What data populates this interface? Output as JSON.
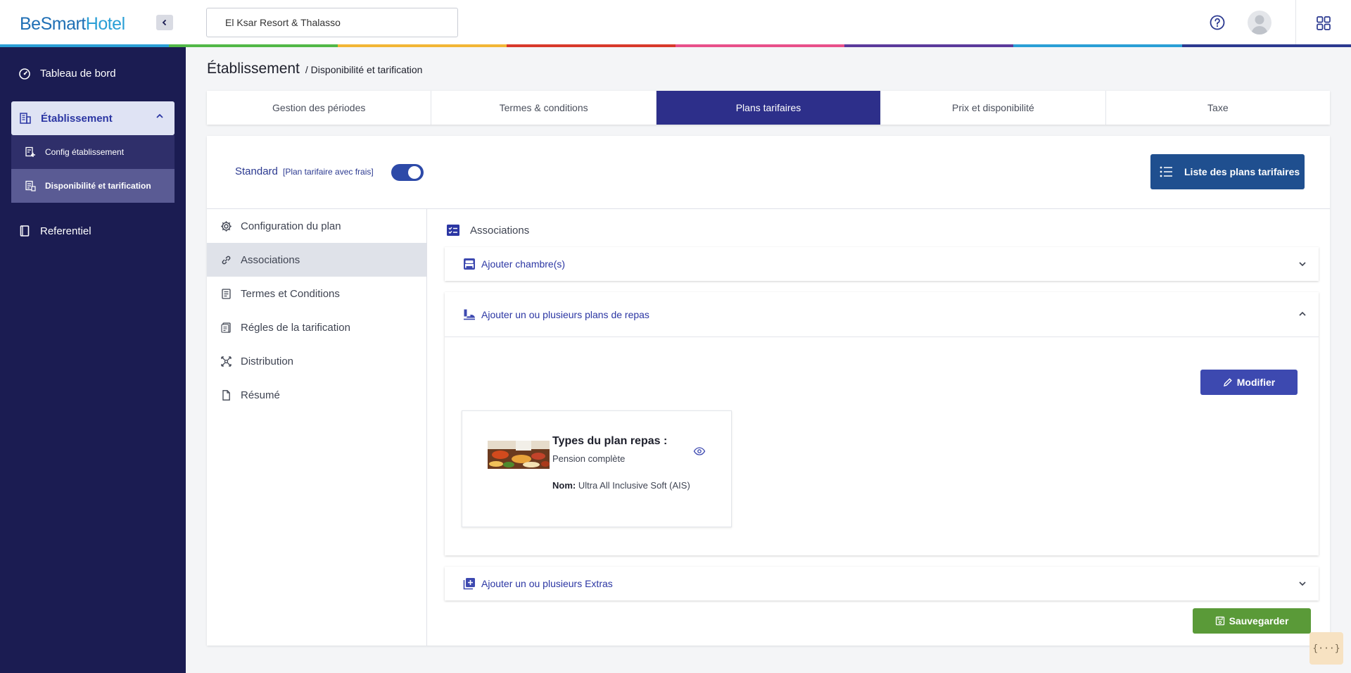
{
  "brand": {
    "part1": "BeSmart",
    "part2": "Hotel"
  },
  "sidebar": {
    "items": [
      {
        "label": "Tableau de bord",
        "icon": "gauge-icon"
      },
      {
        "label": "Établissement",
        "icon": "building-icon"
      },
      {
        "label": "Referentiel",
        "icon": "book-icon"
      }
    ],
    "subitems": [
      {
        "label": "Config établissement",
        "icon": "config-doc-icon"
      },
      {
        "label": "Disponibilité et tarification",
        "icon": "pricing-doc-icon"
      }
    ]
  },
  "topbar": {
    "hotel": "El Ksar Resort & Thalasso"
  },
  "breadcrumb": {
    "title": "Établissement",
    "sub": "/ Disponibilité et tarification"
  },
  "tabs": [
    {
      "label": "Gestion des périodes"
    },
    {
      "label": "Termes & conditions"
    },
    {
      "label": "Plans tarifaires"
    },
    {
      "label": "Prix et disponibilité"
    },
    {
      "label": "Taxe"
    }
  ],
  "plan": {
    "name": "Standard",
    "note": "[Plan tarifaire avec frais]",
    "toggle_on": true,
    "list_button": "Liste des plans tarifaires"
  },
  "left_menu": [
    {
      "label": "Configuration du plan",
      "icon": "gear-icon"
    },
    {
      "label": "Associations",
      "icon": "link-icon"
    },
    {
      "label": "Termes et Conditions",
      "icon": "terms-icon"
    },
    {
      "label": "Régles de la tarification",
      "icon": "rules-icon"
    },
    {
      "label": "Distribution",
      "icon": "distribution-icon"
    },
    {
      "label": "Résumé",
      "icon": "file-icon"
    }
  ],
  "associations": {
    "title": "Associations",
    "rooms": "Ajouter chambre(s)",
    "meals": "Ajouter un ou plusieurs plans de repas",
    "extras": "Ajouter un ou plusieurs Extras",
    "modify_button": "Modifier",
    "card": {
      "type_title": "Types du plan repas :",
      "type_value": "Pension complète",
      "name_label": "Nom:",
      "name_value": "Ultra All Inclusive Soft (AIS)"
    },
    "save_button": "Sauvegarder"
  },
  "widget": "{···}",
  "colors": {
    "sidebar": "#1b1c52",
    "accent": "#2d2f8a",
    "primary_button": "#1f4f8f",
    "save": "#5a9a38",
    "rainbow": [
      "#2a9fd6",
      "#52b848",
      "#f2b636",
      "#d8392b",
      "#e8508a",
      "#5b3a9b",
      "#2a9fd6",
      "#2b3990"
    ]
  }
}
